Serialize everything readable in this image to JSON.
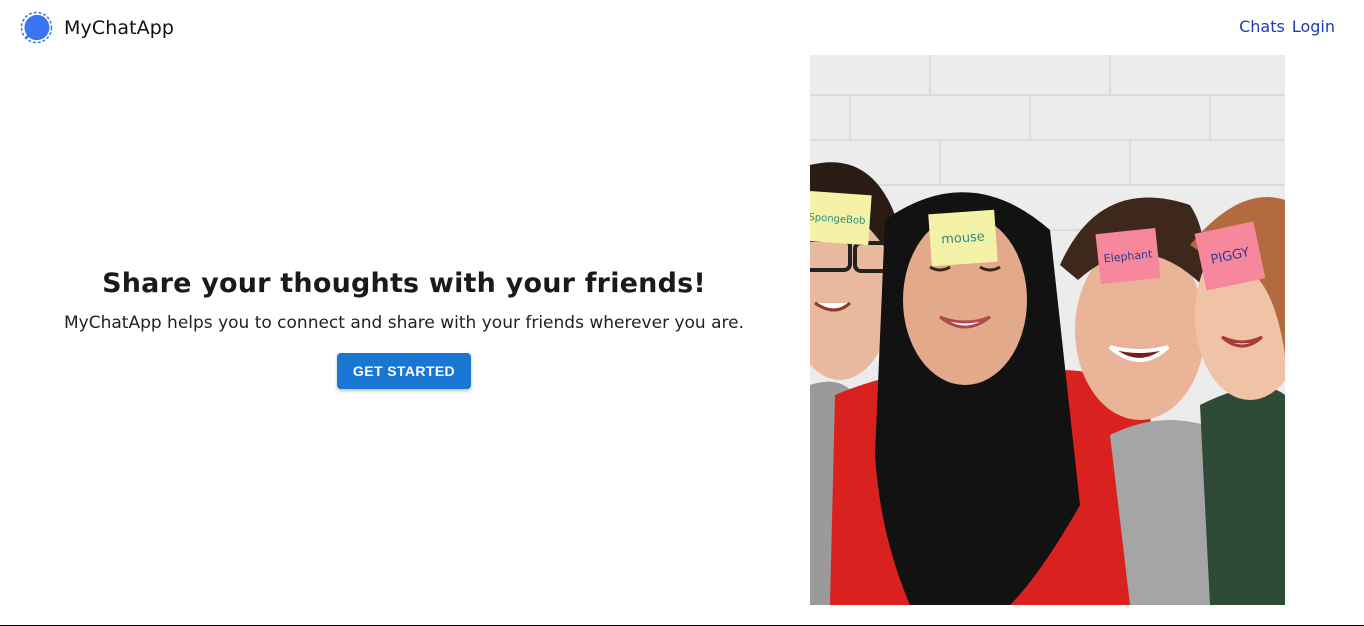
{
  "header": {
    "app_name": "MyChatApp",
    "logo_icon": "chat-bubble-icon",
    "nav": [
      {
        "label": "Chats"
      },
      {
        "label": "Login"
      }
    ]
  },
  "hero": {
    "title": "Share your thoughts with your friends!",
    "subtitle": "MyChatApp helps you to connect and share with your friends wherever you are.",
    "cta_label": "GET STARTED"
  },
  "photo": {
    "sticky_notes": [
      {
        "text": "SpongeBob",
        "color": "#f4f2a6"
      },
      {
        "text": "mouse",
        "color": "#f4f2a6"
      },
      {
        "text": "Elephant",
        "color": "#f7879d"
      },
      {
        "text": "PIGGY",
        "color": "#f7879d"
      }
    ]
  },
  "colors": {
    "accent": "#1976d2",
    "nav_link": "#1c3bb5",
    "logo": "#3a76f0"
  }
}
